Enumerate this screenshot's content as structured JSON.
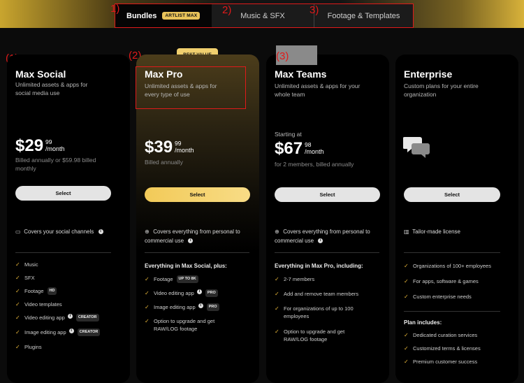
{
  "annotations": {
    "tabs": [
      "1)",
      "2)",
      "3)"
    ],
    "cards": [
      "(1)",
      "(2)",
      "(3)"
    ]
  },
  "tabs": {
    "bundles": "Bundles",
    "bundles_badge": "ARTLIST MAX",
    "music": "Music & SFX",
    "footage": "Footage & Templates"
  },
  "best_value": "BEST VALUE",
  "plans": [
    {
      "name": "Max Social",
      "desc": "Unlimited assets & apps for social media use",
      "price": "$29",
      "cents": "99",
      "per": "/month",
      "billing": "Billed annually or $59.98 billed monthly",
      "button": "Select",
      "cover": "Covers your social channels",
      "features": [
        {
          "text": "Music"
        },
        {
          "text": "SFX"
        },
        {
          "text": "Footage",
          "tag": "HD"
        },
        {
          "text": "Video templates"
        },
        {
          "text": "Video editing app",
          "tag": "CREATOR",
          "info": true
        },
        {
          "text": "Image editing app",
          "tag": "CREATOR",
          "info": true
        },
        {
          "text": "Plugins"
        }
      ]
    },
    {
      "name": "Max Pro",
      "desc": "Unlimited assets & apps for every type of use",
      "price": "$39",
      "cents": "99",
      "per": "/month",
      "billing": "Billed annually",
      "button": "Select",
      "cover": "Covers everything from personal to commercial use",
      "section": "Everything in Max Social, plus:",
      "features": [
        {
          "text": "Footage",
          "tag": "UP TO 8K"
        },
        {
          "text": "Video editing app",
          "tag": "PRO",
          "info": true
        },
        {
          "text": "Image editing app",
          "tag": "PRO",
          "info": true
        },
        {
          "text": "Option to upgrade and get RAW/LOG footage"
        }
      ]
    },
    {
      "name": "Max Teams",
      "desc": "Unlimited assets & apps for your whole team",
      "starting": "Starting at",
      "price": "$67",
      "cents": "98",
      "per": "/month",
      "billing": "for 2 members, billed annually",
      "button": "Select",
      "cover": "Covers everything from personal to commercial use",
      "section": "Everything in Max Pro, including:",
      "features": [
        {
          "text": "2-7 members"
        },
        {
          "text": "Add and remove team members"
        },
        {
          "text": "For organizations of up to 100 employees"
        },
        {
          "text": "Option to upgrade and get RAW/LOG footage"
        }
      ]
    },
    {
      "name": "Enterprise",
      "desc": "Custom plans for your entire organization",
      "button": "Select",
      "cover": "Tailor-made license",
      "features": [
        {
          "text": "Organizations of 100+ employees"
        },
        {
          "text": "For apps, software & games"
        },
        {
          "text": "Custom enterprise needs"
        }
      ],
      "section2": "Plan includes:",
      "features2": [
        {
          "text": "Dedicated curation services"
        },
        {
          "text": "Customized terms & licenses"
        },
        {
          "text": "Premium customer success"
        }
      ]
    }
  ],
  "colors": {
    "accent": "#f2ca58",
    "annotation": "#e01a1a",
    "check": "#e9b83a"
  }
}
